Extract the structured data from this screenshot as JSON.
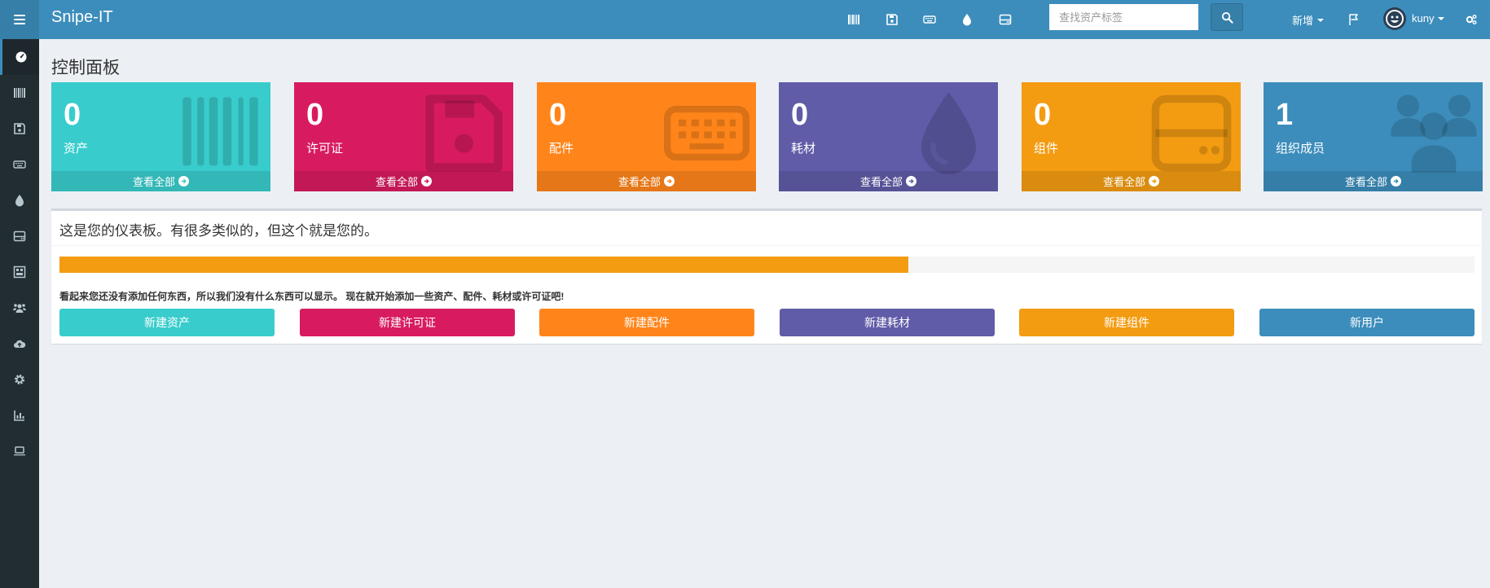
{
  "app": {
    "brand": "Snipe-IT"
  },
  "topbar": {
    "icons": [
      "barcode-icon",
      "floppy-icon",
      "keyboard-icon",
      "drop-icon",
      "hdd-icon"
    ],
    "search_placeholder": "查找资产标签",
    "new_label": "新增",
    "user_name": "kuny"
  },
  "sidebar": {
    "items": [
      "dashboard-icon",
      "barcode-icon",
      "floppy-icon",
      "keyboard-icon",
      "drop-icon",
      "hdd-icon",
      "kit-icon",
      "users-icon",
      "cloud-upload-icon",
      "settings-icon",
      "reports-icon",
      "laptop-icon"
    ]
  },
  "page": {
    "title": "控制面板"
  },
  "stats": [
    {
      "count": "0",
      "label": "资产",
      "footer": "查看全部",
      "color": "#39cccc",
      "icon": "barcode-icon"
    },
    {
      "count": "0",
      "label": "许可证",
      "footer": "查看全部",
      "color": "#d81b60",
      "icon": "floppy-icon"
    },
    {
      "count": "0",
      "label": "配件",
      "footer": "查看全部",
      "color": "#ff851b",
      "icon": "keyboard-icon"
    },
    {
      "count": "0",
      "label": "耗材",
      "footer": "查看全部",
      "color": "#605ca8",
      "icon": "drop-icon"
    },
    {
      "count": "0",
      "label": "组件",
      "footer": "查看全部",
      "color": "#f39c12",
      "icon": "hdd-icon"
    },
    {
      "count": "1",
      "label": "组织成员",
      "footer": "查看全部",
      "color": "#3c8dbc",
      "icon": "users-icon"
    }
  ],
  "panel": {
    "title": "这是您的仪表板。有很多类似的，但这个就是您的。",
    "progress": 0.6,
    "message": "看起来您还没有添加任何东西，所以我们没有什么东西可以显示。 现在就开始添加一些资产、配件、耗材或许可证吧!",
    "buttons": [
      {
        "label": "新建资产",
        "color": "#39cccc"
      },
      {
        "label": "新建许可证",
        "color": "#d81b60"
      },
      {
        "label": "新建配件",
        "color": "#ff851b"
      },
      {
        "label": "新建耗材",
        "color": "#605ca8"
      },
      {
        "label": "新建组件",
        "color": "#f39c12"
      },
      {
        "label": "新用户",
        "color": "#3c8dbc"
      }
    ]
  }
}
